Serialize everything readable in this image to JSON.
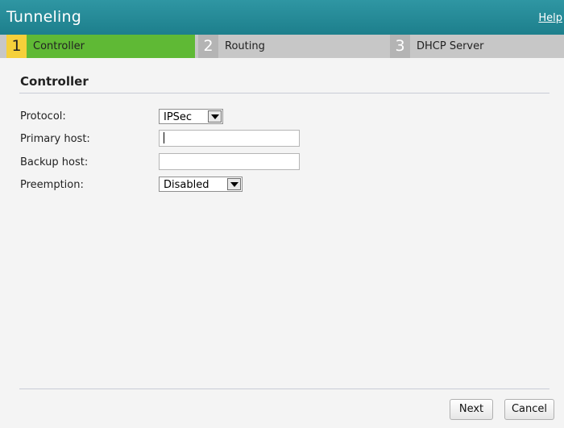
{
  "header": {
    "title": "Tunneling",
    "help_label": "Help"
  },
  "tabs": [
    {
      "num": "1",
      "label": "Controller",
      "active": true
    },
    {
      "num": "2",
      "label": "Routing",
      "active": false
    },
    {
      "num": "3",
      "label": "DHCP Server",
      "active": false
    }
  ],
  "section": {
    "title": "Controller"
  },
  "form": {
    "protocol": {
      "label": "Protocol:",
      "value": "IPSec"
    },
    "primary_host": {
      "label": "Primary host:",
      "value": ""
    },
    "backup_host": {
      "label": "Backup host:",
      "value": ""
    },
    "preemption": {
      "label": "Preemption:",
      "value": "Disabled"
    }
  },
  "buttons": {
    "next": "Next",
    "cancel": "Cancel"
  },
  "colors": {
    "titlebar": "#1d7f8c",
    "active_tab": "#5fb935",
    "active_tab_number": "#f5d03a",
    "inactive_tab": "#c7c7c7"
  }
}
